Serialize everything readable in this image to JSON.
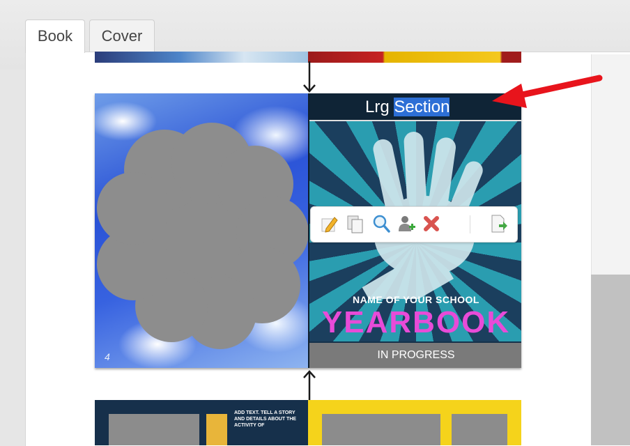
{
  "tabs": [
    {
      "label": "Book",
      "active": true
    },
    {
      "label": "Cover",
      "active": false
    }
  ],
  "main_spread": {
    "left_page_number": "4",
    "section_title_prefix": "Lrg ",
    "section_title_highlight": "Section",
    "school_name": "NAME OF YOUR SCHOOL",
    "title": "YEARBOOK",
    "status": "IN PROGRESS"
  },
  "toolbar": {
    "icons": [
      "edit-icon",
      "copy-icon",
      "zoom-icon",
      "add-user-icon",
      "delete-icon",
      "export-icon"
    ]
  },
  "bottom_spread": {
    "blurb": "ADD TEXT. TELL A STORY AND DETAILS ABOUT THE ACTIVITY OF"
  },
  "colors": {
    "annotation_arrow": "#e8141c",
    "selection_highlight": "#2d6fd6",
    "title_pink": "#e84bd8",
    "status_gray": "#7a7a7a",
    "scroll_thumb": "#c1c1c1"
  }
}
